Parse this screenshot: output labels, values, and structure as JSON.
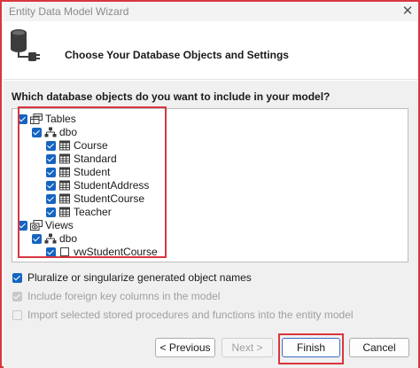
{
  "window": {
    "title": "Entity Data Model Wizard",
    "close_glyph": "✕"
  },
  "header": {
    "title": "Choose Your Database Objects and Settings"
  },
  "content": {
    "question": "Which database objects do you want to include in your model?",
    "tree": {
      "tables": {
        "label": "Tables",
        "schema": "dbo",
        "items": [
          "Course",
          "Standard",
          "Student",
          "StudentAddress",
          "StudentCourse",
          "Teacher"
        ]
      },
      "views": {
        "label": "Views",
        "schema": "dbo",
        "items": [
          "vwStudentCourse"
        ]
      }
    },
    "options": {
      "pluralize": "Pluralize or singularize generated object names",
      "foreign_keys": "Include foreign key columns in the model",
      "stored_procs": "Import selected stored procedures and functions into the entity model"
    }
  },
  "buttons": {
    "previous": "< Previous",
    "next": "Next >",
    "finish": "Finish",
    "cancel": "Cancel"
  },
  "colors": {
    "accent": "#1565c0",
    "highlight": "#d9363e"
  },
  "icons": [
    "database-plug-icon",
    "table-group-icon",
    "schema-icon",
    "table-icon",
    "view-group-icon",
    "view-icon"
  ]
}
